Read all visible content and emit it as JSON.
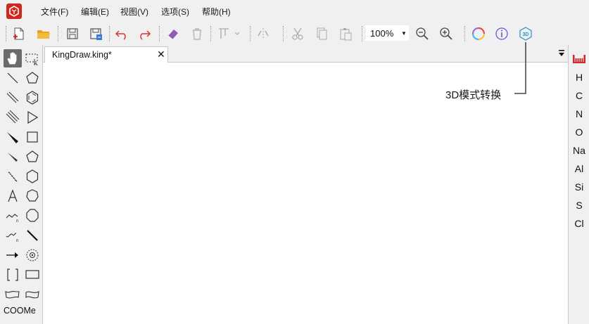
{
  "menubar": {
    "items": [
      {
        "label": "文件(F)"
      },
      {
        "label": "编辑(E)"
      },
      {
        "label": "视图(V)"
      },
      {
        "label": "选项(S)"
      },
      {
        "label": "帮助(H)"
      }
    ]
  },
  "toolbar": {
    "zoom_value": "100%"
  },
  "document": {
    "tab_title": "KingDraw.king*",
    "close_glyph": "✕"
  },
  "left_palette": {
    "text_tool_label": "COOMe"
  },
  "right_palette": {
    "elements": [
      "H",
      "C",
      "N",
      "O",
      "Na",
      "Al",
      "Si",
      "S",
      "Cl"
    ]
  },
  "annotation": {
    "label": "3D模式转换"
  },
  "colors": {
    "brand_red": "#d4241c",
    "undo_red": "#d9363e",
    "eraser_purple": "#8e5bb5",
    "folder_orange": "#e9a21b",
    "info_purple": "#6a5acd",
    "three_d_teal": "#3a8fb5",
    "palette_red": "#c8282e"
  }
}
